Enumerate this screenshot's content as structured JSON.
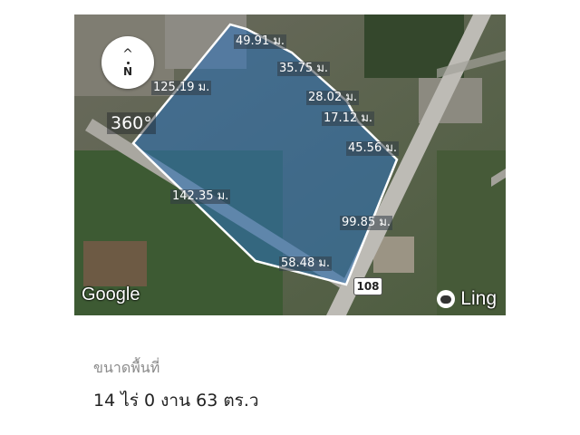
{
  "map": {
    "dimensions": {
      "d1": "49.91 ม.",
      "d2": "35.75 ม.",
      "d3": "125.19 ม.",
      "d4": "28.02 ม.",
      "d5": "17.12 ม.",
      "d6": "45.56 ม.",
      "d7": "142.35 ม.",
      "d8": "99.85 ม.",
      "d9": "58.48 ม."
    },
    "compass_label": "N",
    "rotate_label": "360°",
    "provider": "Google",
    "watermark": "Ling",
    "route_number": "108"
  },
  "info": {
    "area_label": "ขนาดพื้นที่",
    "area_value": "14 ไร่ 0 งาน 63 ตร.ว"
  },
  "colors": {
    "parcel_fill": "#2f6fb3",
    "parcel_stroke": "#ffffff"
  }
}
